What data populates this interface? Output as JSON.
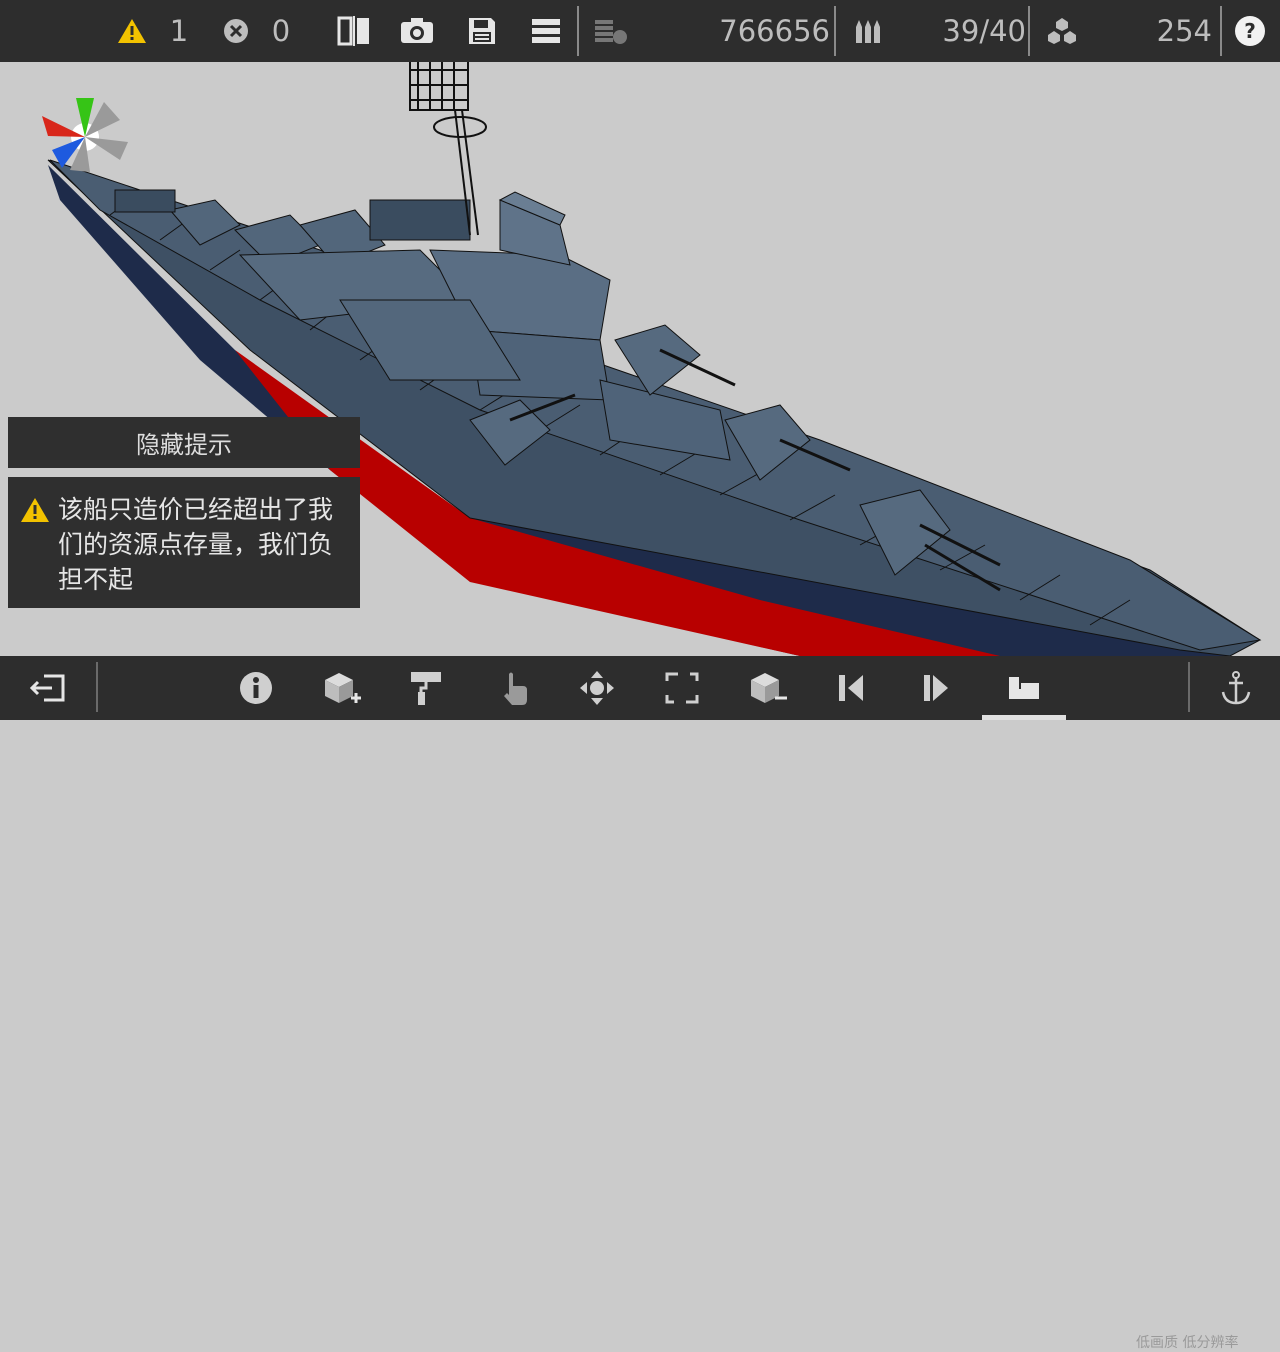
{
  "topbar": {
    "warnings_count": "1",
    "errors_count": "0",
    "funds": "766656",
    "ammo": "39/40",
    "parts": "254",
    "icons": [
      "warning-icon",
      "error-icon",
      "mirror-icon",
      "camera-icon",
      "save-icon",
      "menu-icon",
      "resources-icon",
      "ammo-icon",
      "parts-icon",
      "help-icon"
    ]
  },
  "hint": {
    "toggle_label": "隐藏提示",
    "message": "该船只造价已经超出了我们的资源点存量，我们负担不起"
  },
  "bottombar": {
    "quality_label": "低画质 低分辨率",
    "tools": [
      "exit-icon",
      "info-icon",
      "add-part-icon",
      "paint-roller-icon",
      "hand-pointer-icon",
      "move-icon",
      "rotate-frame-icon",
      "remove-part-icon",
      "step-back-icon",
      "step-forward-icon",
      "sofa-icon",
      "anchor-icon"
    ]
  },
  "colors": {
    "bar_bg": "#2d2d2d",
    "viewport_bg": "#cbcbcb",
    "warning_yellow": "#f2c200",
    "hull_upper": "#3e5064",
    "hull_stripe": "#1e2b4a",
    "hull_waterline": "#b80000"
  }
}
